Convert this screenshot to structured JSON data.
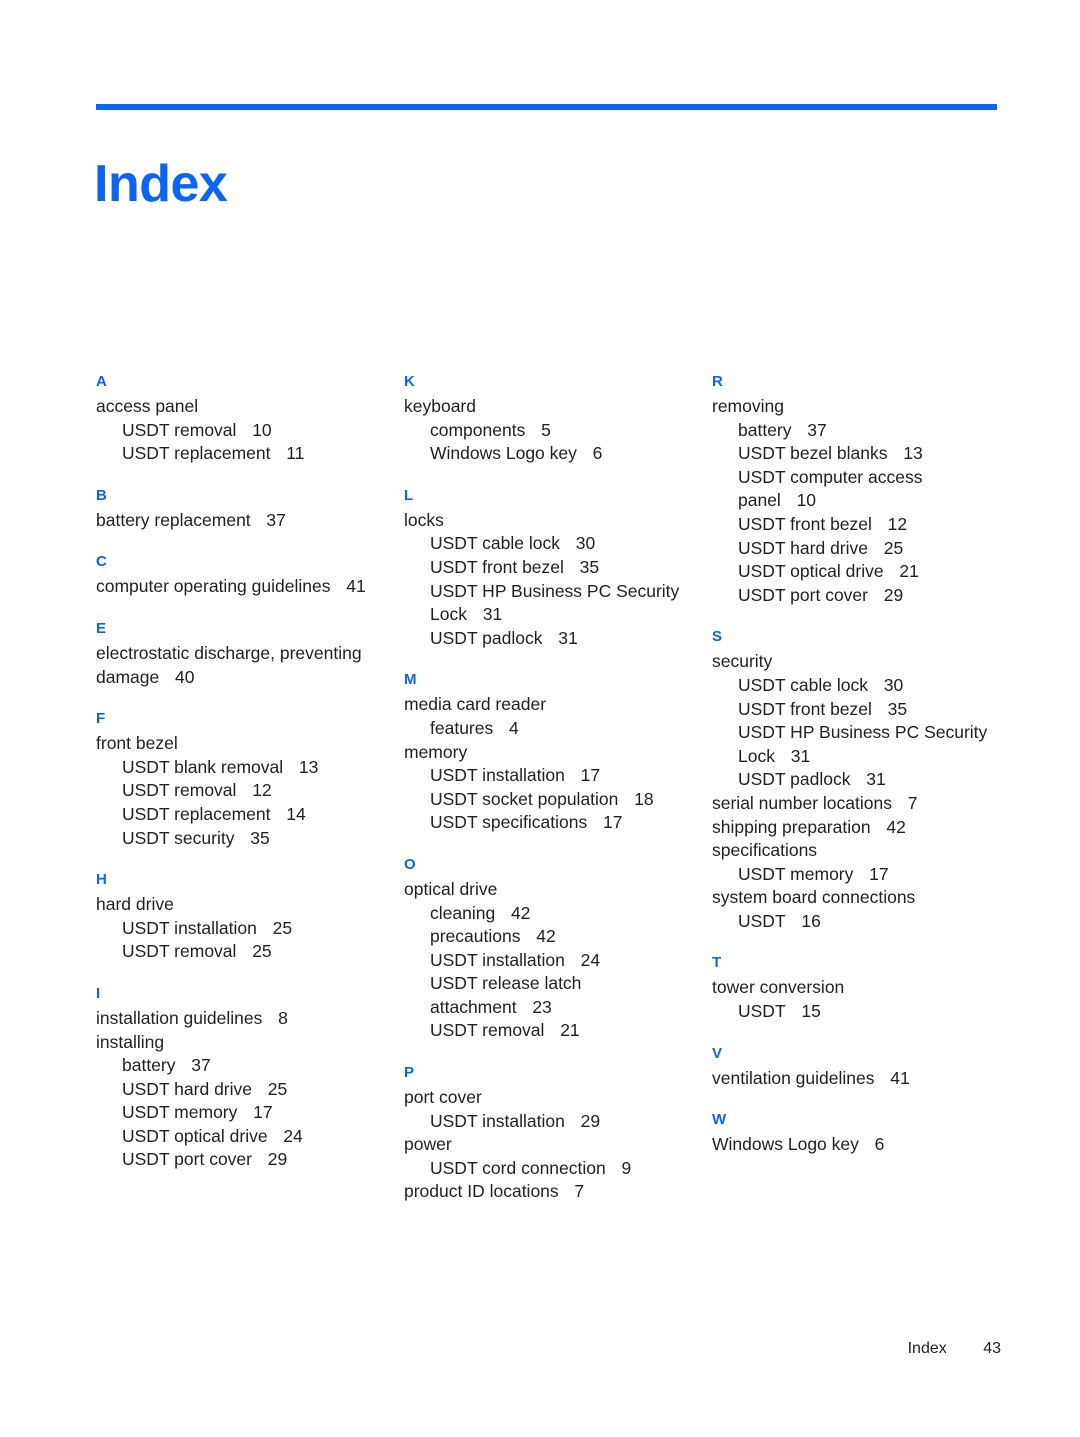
{
  "title": "Index",
  "accent_color": "#0a64f5",
  "text_color": "#231f20",
  "footer": {
    "label": "Index",
    "page_number": "43"
  },
  "columns": [
    {
      "groups": [
        {
          "letter": "A",
          "entries": [
            {
              "level": 1,
              "text": "access panel",
              "page": ""
            },
            {
              "level": 2,
              "text": "USDT removal",
              "page": "10"
            },
            {
              "level": 2,
              "text": "USDT replacement",
              "page": "11"
            }
          ]
        },
        {
          "letter": "B",
          "entries": [
            {
              "level": 1,
              "text": "battery replacement",
              "page": "37"
            }
          ]
        },
        {
          "letter": "C",
          "entries": [
            {
              "level": 1,
              "text": "computer operating guidelines",
              "page": "41"
            }
          ]
        },
        {
          "letter": "E",
          "entries": [
            {
              "level": 1,
              "text": "electrostatic discharge, preventing damage",
              "page": "40"
            }
          ]
        },
        {
          "letter": "F",
          "entries": [
            {
              "level": 1,
              "text": "front bezel",
              "page": ""
            },
            {
              "level": 2,
              "text": "USDT blank removal",
              "page": "13"
            },
            {
              "level": 2,
              "text": "USDT removal",
              "page": "12"
            },
            {
              "level": 2,
              "text": "USDT replacement",
              "page": "14"
            },
            {
              "level": 2,
              "text": "USDT security",
              "page": "35"
            }
          ]
        },
        {
          "letter": "H",
          "entries": [
            {
              "level": 1,
              "text": "hard drive",
              "page": ""
            },
            {
              "level": 2,
              "text": "USDT installation",
              "page": "25"
            },
            {
              "level": 2,
              "text": "USDT removal",
              "page": "25"
            }
          ]
        },
        {
          "letter": "I",
          "entries": [
            {
              "level": 1,
              "text": "installation guidelines",
              "page": "8"
            },
            {
              "level": 1,
              "text": "installing",
              "page": ""
            },
            {
              "level": 2,
              "text": "battery",
              "page": "37"
            },
            {
              "level": 2,
              "text": "USDT hard drive",
              "page": "25"
            },
            {
              "level": 2,
              "text": "USDT memory",
              "page": "17"
            },
            {
              "level": 2,
              "text": "USDT optical drive",
              "page": "24"
            },
            {
              "level": 2,
              "text": "USDT port cover",
              "page": "29"
            }
          ]
        }
      ]
    },
    {
      "groups": [
        {
          "letter": "K",
          "entries": [
            {
              "level": 1,
              "text": "keyboard",
              "page": ""
            },
            {
              "level": 2,
              "text": "components",
              "page": "5"
            },
            {
              "level": 2,
              "text": "Windows Logo key",
              "page": "6"
            }
          ]
        },
        {
          "letter": "L",
          "entries": [
            {
              "level": 1,
              "text": "locks",
              "page": ""
            },
            {
              "level": 2,
              "text": "USDT cable lock",
              "page": "30"
            },
            {
              "level": 2,
              "text": "USDT front bezel",
              "page": "35"
            },
            {
              "level": 2,
              "text": "USDT HP Business PC Security Lock",
              "page": "31"
            },
            {
              "level": 2,
              "text": "USDT padlock",
              "page": "31"
            }
          ]
        },
        {
          "letter": "M",
          "entries": [
            {
              "level": 1,
              "text": "media card reader",
              "page": ""
            },
            {
              "level": 2,
              "text": "features",
              "page": "4"
            },
            {
              "level": 1,
              "text": "memory",
              "page": ""
            },
            {
              "level": 2,
              "text": "USDT installation",
              "page": "17"
            },
            {
              "level": 2,
              "text": "USDT socket population",
              "page": "18"
            },
            {
              "level": 2,
              "text": "USDT specifications",
              "page": "17"
            }
          ]
        },
        {
          "letter": "O",
          "entries": [
            {
              "level": 1,
              "text": "optical drive",
              "page": ""
            },
            {
              "level": 2,
              "text": "cleaning",
              "page": "42"
            },
            {
              "level": 2,
              "text": "precautions",
              "page": "42"
            },
            {
              "level": 2,
              "text": "USDT installation",
              "page": "24"
            },
            {
              "level": 2,
              "text": "USDT release latch attachment",
              "page": "23"
            },
            {
              "level": 2,
              "text": "USDT removal",
              "page": "21"
            }
          ]
        },
        {
          "letter": "P",
          "entries": [
            {
              "level": 1,
              "text": "port cover",
              "page": ""
            },
            {
              "level": 2,
              "text": "USDT installation",
              "page": "29"
            },
            {
              "level": 1,
              "text": "power",
              "page": ""
            },
            {
              "level": 2,
              "text": "USDT cord connection",
              "page": "9"
            },
            {
              "level": 1,
              "text": "product ID locations",
              "page": "7"
            }
          ]
        }
      ]
    },
    {
      "groups": [
        {
          "letter": "R",
          "entries": [
            {
              "level": 1,
              "text": "removing",
              "page": ""
            },
            {
              "level": 2,
              "text": "battery",
              "page": "37"
            },
            {
              "level": 2,
              "text": "USDT bezel blanks",
              "page": "13"
            },
            {
              "level": 2,
              "text": "USDT computer access panel",
              "page": "10"
            },
            {
              "level": 2,
              "text": "USDT front bezel",
              "page": "12"
            },
            {
              "level": 2,
              "text": "USDT hard drive",
              "page": "25"
            },
            {
              "level": 2,
              "text": "USDT optical drive",
              "page": "21"
            },
            {
              "level": 2,
              "text": "USDT port cover",
              "page": "29"
            }
          ]
        },
        {
          "letter": "S",
          "entries": [
            {
              "level": 1,
              "text": "security",
              "page": ""
            },
            {
              "level": 2,
              "text": "USDT cable lock",
              "page": "30"
            },
            {
              "level": 2,
              "text": "USDT front bezel",
              "page": "35"
            },
            {
              "level": 2,
              "text": "USDT HP Business PC Security Lock",
              "page": "31"
            },
            {
              "level": 2,
              "text": "USDT padlock",
              "page": "31"
            },
            {
              "level": 1,
              "text": "serial number locations",
              "page": "7"
            },
            {
              "level": 1,
              "text": "shipping preparation",
              "page": "42"
            },
            {
              "level": 1,
              "text": "specifications",
              "page": ""
            },
            {
              "level": 2,
              "text": "USDT memory",
              "page": "17"
            },
            {
              "level": 1,
              "text": "system board connections",
              "page": ""
            },
            {
              "level": 2,
              "text": "USDT",
              "page": "16"
            }
          ]
        },
        {
          "letter": "T",
          "entries": [
            {
              "level": 1,
              "text": "tower conversion",
              "page": ""
            },
            {
              "level": 2,
              "text": "USDT",
              "page": "15"
            }
          ]
        },
        {
          "letter": "V",
          "entries": [
            {
              "level": 1,
              "text": "ventilation guidelines",
              "page": "41"
            }
          ]
        },
        {
          "letter": "W",
          "entries": [
            {
              "level": 1,
              "text": "Windows Logo key",
              "page": "6"
            }
          ]
        }
      ]
    }
  ]
}
